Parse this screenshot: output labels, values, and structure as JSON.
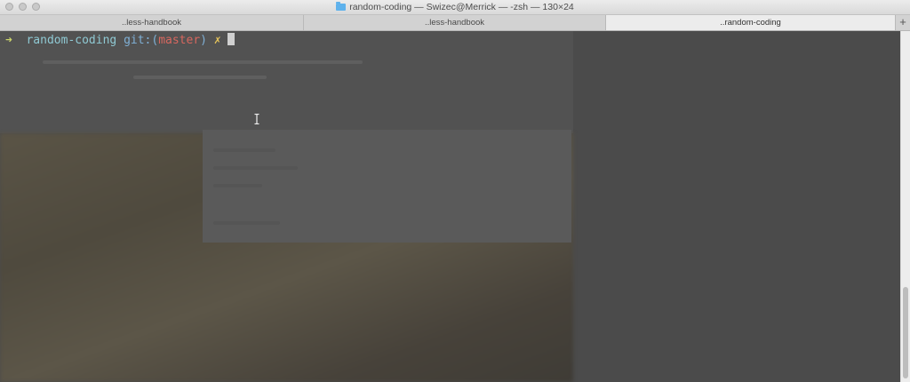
{
  "window": {
    "title": "random-coding — Swizec@Merrick — -zsh — 130×24",
    "title_icon": "folder-icon"
  },
  "tabs": [
    {
      "label": "..less-handbook",
      "active": false
    },
    {
      "label": "..less-handbook",
      "active": false
    },
    {
      "label": "..random-coding",
      "active": true
    }
  ],
  "tab_add_label": "+",
  "prompt": {
    "arrow": "➜",
    "directory": "random-coding",
    "git_prefix": "git:(",
    "branch": "master",
    "git_suffix": ")",
    "dirty_mark": "✗"
  },
  "scrollbar": {
    "thumb_start": 0.73,
    "thumb_end": 0.99
  },
  "colors": {
    "prompt_arrow": "#c9d36a",
    "directory": "#8fc9d3",
    "branch": "#d8675f",
    "dirty_mark": "#e7c45a",
    "terminal_background": "#4b4b4b"
  }
}
